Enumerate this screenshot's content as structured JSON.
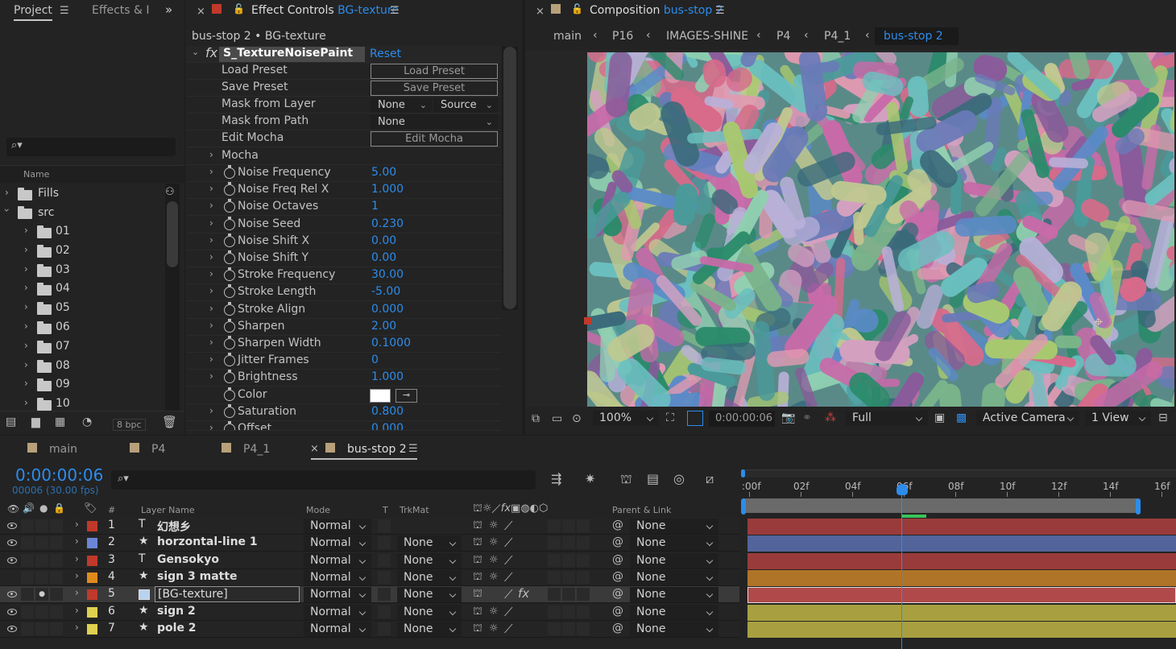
{
  "project": {
    "tabs": [
      "Project",
      "Effects & I"
    ],
    "col_name": "Name",
    "bpc": "8 bpc",
    "items": [
      "Fills",
      "src",
      "01",
      "02",
      "03",
      "04",
      "05",
      "06",
      "07",
      "08",
      "09",
      "10"
    ]
  },
  "effects": {
    "tab": "Effect Controls",
    "tab_target": "BG-texture",
    "breadcrumb": "bus-stop 2 • BG-texture",
    "effect_name": "S_TextureNoisePaint",
    "reset": "Reset",
    "fx": "fx",
    "load_preset": "Load Preset",
    "save_preset": "Save Preset",
    "mask_from_layer": "Mask from Layer",
    "mask_from_path": "Mask from Path",
    "edit_mocha": "Edit Mocha",
    "mocha": "Mocha",
    "dd_none": "None",
    "dd_source": "Source",
    "params": [
      {
        "label": "Noise Frequency",
        "value": "5.00"
      },
      {
        "label": "Noise Freq Rel X",
        "value": "1.000"
      },
      {
        "label": "Noise Octaves",
        "value": "1"
      },
      {
        "label": "Noise Seed",
        "value": "0.230"
      },
      {
        "label": "Noise Shift X",
        "value": "0.00"
      },
      {
        "label": "Noise Shift Y",
        "value": "0.00"
      },
      {
        "label": "Stroke Frequency",
        "value": "30.00"
      },
      {
        "label": "Stroke Length",
        "value": "-5.00"
      },
      {
        "label": "Stroke Align",
        "value": "0.000"
      },
      {
        "label": "Sharpen",
        "value": "2.00"
      },
      {
        "label": "Sharpen Width",
        "value": "0.1000"
      },
      {
        "label": "Jitter Frames",
        "value": "0"
      },
      {
        "label": "Brightness",
        "value": "1.000"
      },
      {
        "label": "Color",
        "value": ""
      },
      {
        "label": "Saturation",
        "value": "0.800"
      },
      {
        "label": "Offset",
        "value": "0.000"
      }
    ]
  },
  "comp": {
    "tab": "Composition",
    "tab_target": "bus-stop 2",
    "crumbs": [
      "main",
      "P16",
      "IMAGES-SHINE",
      "P4",
      "P4_1",
      "bus-stop 2"
    ],
    "zoom": "100%",
    "timecode": "0:00:00:06",
    "resolution": "Full",
    "camera": "Active Camera",
    "views": "1 View"
  },
  "timeline": {
    "tabs": [
      "main",
      "P4",
      "P4_1",
      "bus-stop 2"
    ],
    "timecode": "0:00:00:06",
    "frames": "00006 (30.00 fps)",
    "cols": {
      "num": "#",
      "layer_name": "Layer Name",
      "mode": "Mode",
      "t": "T",
      "trkmat": "TrkMat",
      "parent": "Parent & Link"
    },
    "ruler": [
      ":00f",
      "02f",
      "04f",
      "06f",
      "08f",
      "10f",
      "12f",
      "14f",
      "16f"
    ],
    "layers": [
      {
        "num": "1",
        "name": "幻想乡",
        "type": "T",
        "color": "#c0392b",
        "mode": "Normal",
        "trkmat": "",
        "parent": "None",
        "bar": "#9a3b3b"
      },
      {
        "num": "2",
        "name": "horzontal-line 1",
        "type": "★",
        "color": "#6a86d8",
        "mode": "Normal",
        "trkmat": "None",
        "parent": "None",
        "bar": "#52649a"
      },
      {
        "num": "3",
        "name": "Gensokyo",
        "type": "T",
        "color": "#c0392b",
        "mode": "Normal",
        "trkmat": "None",
        "parent": "None",
        "bar": "#9a3b3b"
      },
      {
        "num": "4",
        "name": "sign 3 matte",
        "type": "★",
        "color": "#e08a1e",
        "mode": "Normal",
        "trkmat": "None",
        "parent": "None",
        "bar": "#b07428"
      },
      {
        "num": "5",
        "name": "[BG-texture]",
        "type": "",
        "color": "#c0392b",
        "mode": "Normal",
        "trkmat": "None",
        "parent": "None",
        "bar": "#b04a4a"
      },
      {
        "num": "6",
        "name": "sign 2",
        "type": "★",
        "color": "#e0d050",
        "mode": "Normal",
        "trkmat": "None",
        "parent": "None",
        "bar": "#a8a040"
      },
      {
        "num": "7",
        "name": "pole 2",
        "type": "★",
        "color": "#e0d050",
        "mode": "Normal",
        "trkmat": "None",
        "parent": "None",
        "bar": "#a8a040"
      }
    ]
  }
}
